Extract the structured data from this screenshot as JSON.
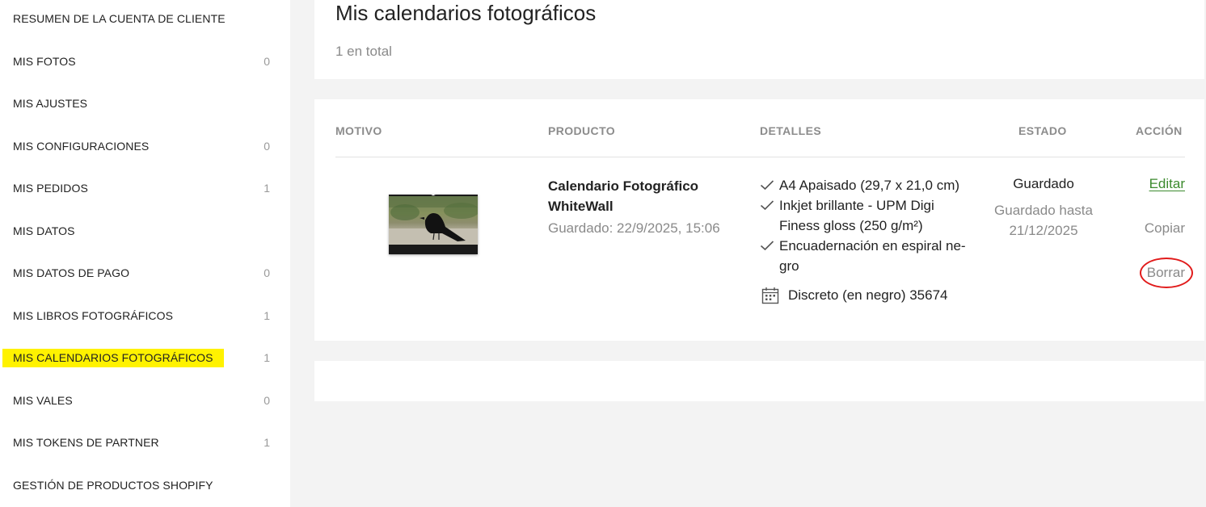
{
  "sidebar": {
    "items": [
      {
        "label": "RESUMEN DE LA CUENTA DE CLIENTE",
        "count": ""
      },
      {
        "label": "MIS FOTOS",
        "count": "0"
      },
      {
        "label": "MIS AJUSTES",
        "count": ""
      },
      {
        "label": "MIS CONFIGURACIONES",
        "count": "0"
      },
      {
        "label": "MIS PEDIDOS",
        "count": "1"
      },
      {
        "label": "MIS DATOS",
        "count": ""
      },
      {
        "label": "MIS DATOS DE PAGO",
        "count": "0"
      },
      {
        "label": "MIS LIBROS FOTOGRÁFICOS",
        "count": "1"
      },
      {
        "label": "MIS CALENDARIOS FOTOGRÁFICOS",
        "count": "1"
      },
      {
        "label": "MIS VALES",
        "count": "0"
      },
      {
        "label": "MIS TOKENS DE PARTNER",
        "count": "1"
      },
      {
        "label": "GESTIÓN DE PRODUCTOS SHOPIFY",
        "count": ""
      }
    ],
    "active_index": 8,
    "highlight_color": "#fff200"
  },
  "main": {
    "title": "Mis calendarios fotográficos",
    "total": "1 en total",
    "table": {
      "headers": {
        "motivo": "MOTIVO",
        "producto": "PRODUCTO",
        "detalles": "DETALLES",
        "estado": "ESTADO",
        "accion": "ACCIÓN"
      },
      "row": {
        "thumbnail": "calendar-thumbnail-crow",
        "product_name": "Calendario Fotográfico WhiteWall",
        "saved": "Guardado: 22/9/2025, 15:06",
        "details": [
          "A4 Apaisado (29,7 x 21,0 cm)",
          "Inkjet brillante - UPM Digi Finess gloss (250 g/m²)",
          "Encuadernación en espiral ne-gro"
        ],
        "calendar_detail": "Discreto (en negro) 35674",
        "state": "Guardado",
        "state_sub": "Guardado hasta 21/12/2025",
        "actions": {
          "edit": "Editar",
          "copy": "Copiar",
          "delete": "Borrar"
        }
      }
    }
  },
  "colors": {
    "accent_green": "#3c8a2e",
    "annotation_red": "#e11b1b",
    "muted": "#8a8a8a"
  }
}
